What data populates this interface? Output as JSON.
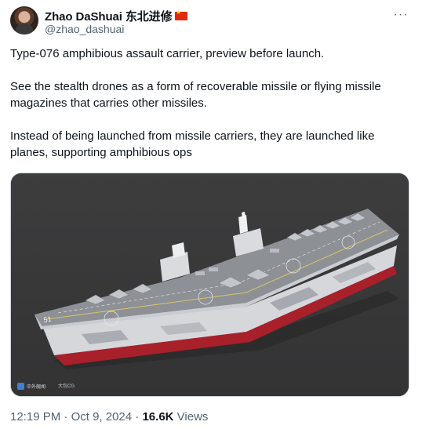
{
  "author": {
    "display_name": "Zhao DaShuai 东北进修",
    "handle": "@zhao_dashuai",
    "avatar_icon": "profile-photo",
    "flag_icon": "china-flag-icon"
  },
  "menu": {
    "icon": "more-horizontal-icon",
    "glyph": "···"
  },
  "tweet": {
    "paragraphs": [
      "Type-076 amphibious assault carrier, preview before launch.",
      "See the stealth drones as a form of recoverable missile or flying missile magazines that carries other missiles.",
      "Instead of being launched from missile carriers, they are launched like planes, supporting amphibious ops"
    ]
  },
  "media": {
    "watermark_left": "中外舰闻",
    "watermark_right": "大包CG",
    "hull_number": "51",
    "colors": {
      "background": "#3a3a3b",
      "deck": "#8b8f95",
      "hull": "#d7d9dd",
      "waterline": "#b5202a"
    }
  },
  "meta": {
    "time": "12:19 PM",
    "separator": "·",
    "date": "Oct 9, 2024",
    "views_count": "16.6K",
    "views_label": "Views"
  }
}
